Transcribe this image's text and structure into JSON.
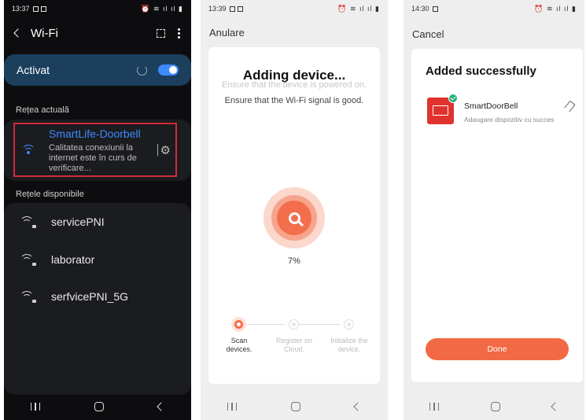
{
  "screen1": {
    "status_time": "13:37",
    "title": "Wi-Fi",
    "toggle_label": "Activat",
    "current_section": "Rețea actuală",
    "current_network": {
      "name": "SmartLife-Doorbell",
      "status": "Calitatea conexiunii la internet este în curs de verificare..."
    },
    "available_section": "Rețele disponibile",
    "networks": [
      {
        "name": "servicePNI",
        "secured": true
      },
      {
        "name": "laborator",
        "secured": true
      },
      {
        "name": "serfvicePNI_5G",
        "secured": true
      }
    ],
    "colors": {
      "accent": "#3d8bfd",
      "highlight": "#d32a3a",
      "toggle_bar": "#1c3f5e"
    }
  },
  "screen2": {
    "status_time": "13:39",
    "cancel_label": "Anulare",
    "title": "Adding device...",
    "hint_faded": "Ensure that the device is powered on.",
    "hint": "Ensure that the Wi-Fi signal is good.",
    "progress": "7%",
    "steps": [
      {
        "label": "Scan devices.",
        "active": true
      },
      {
        "label": "Register on Cloud.",
        "active": false
      },
      {
        "label": "Initialize the device.",
        "active": false
      }
    ],
    "colors": {
      "accent": "#f26e4c"
    }
  },
  "screen3": {
    "status_time": "14:30",
    "cancel_label": "Cancel",
    "title": "Added successfully",
    "device": {
      "name": "SmartDoorBell",
      "subtitle": "Adaugare dispozitiv cu succes"
    },
    "done_label": "Done",
    "colors": {
      "accent": "#f26a45",
      "device_icon": "#e0332f",
      "success": "#27b37a"
    }
  }
}
